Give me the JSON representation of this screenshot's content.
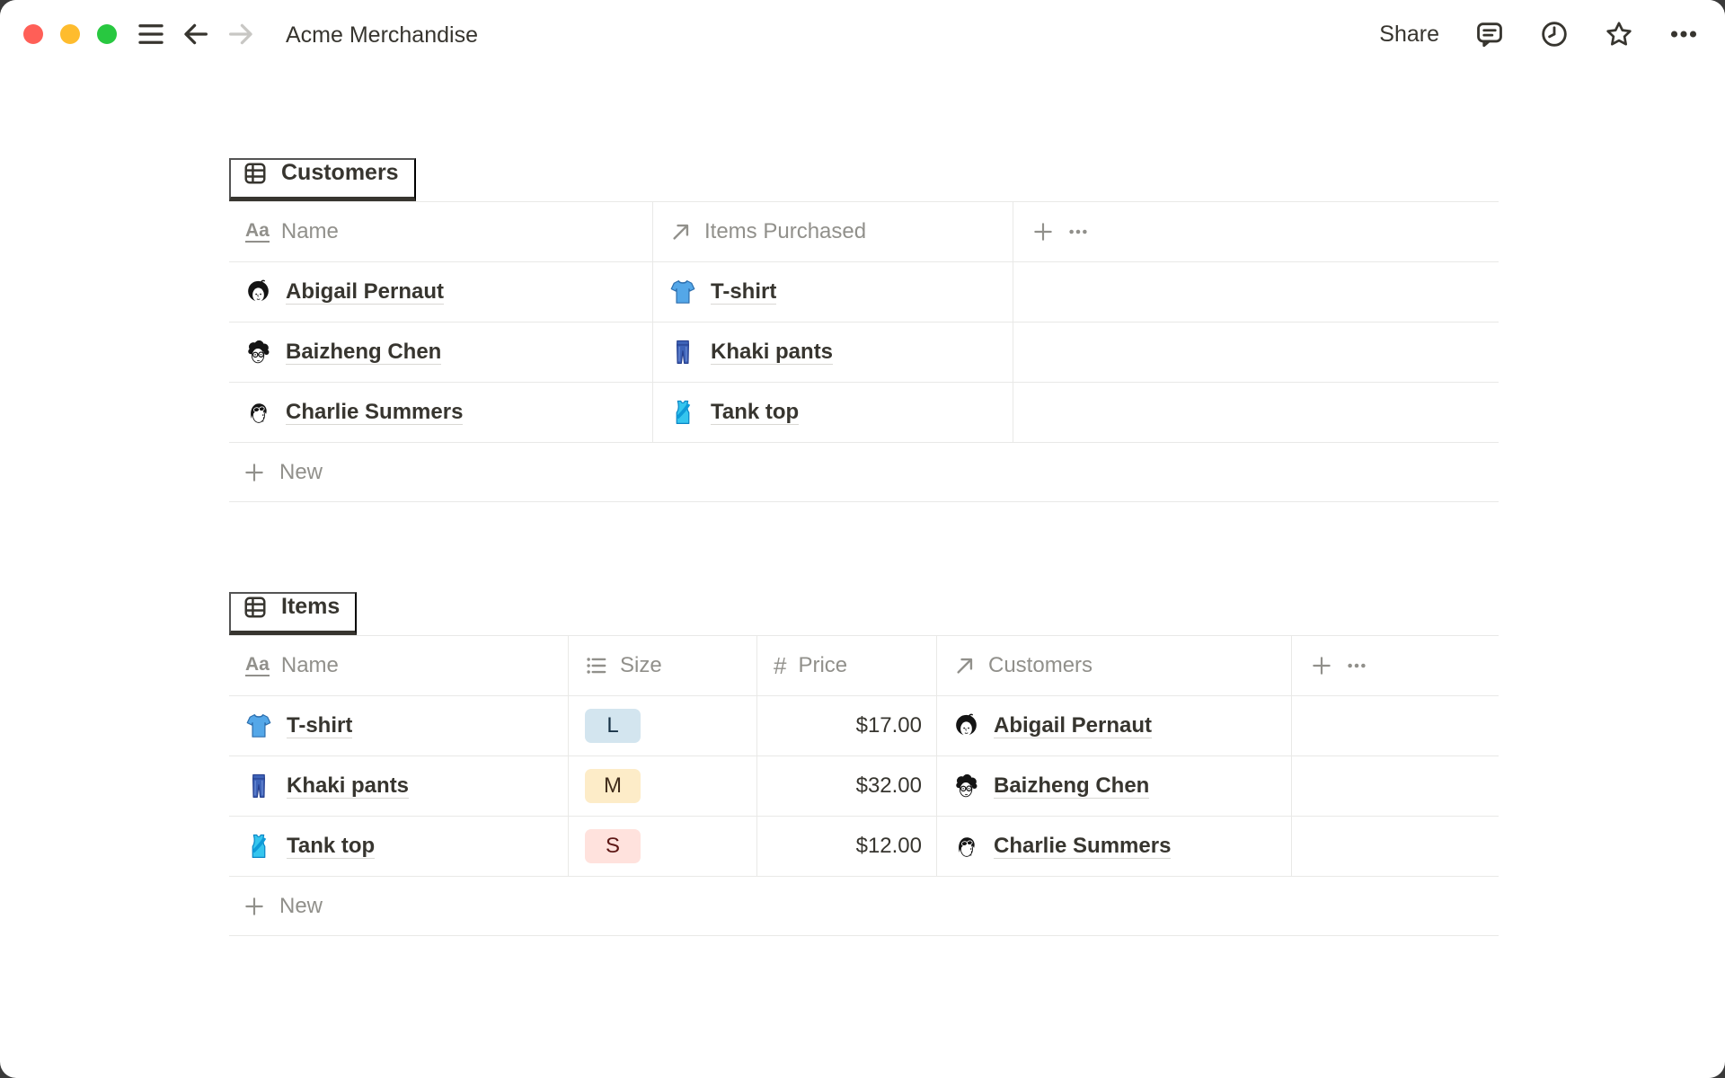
{
  "window": {
    "title": "Acme Merchandise",
    "traffic_lights": [
      "close",
      "minimize",
      "zoom"
    ]
  },
  "toolbar": {
    "share_label": "Share",
    "icons": [
      "comments-icon",
      "updates-clock-icon",
      "favorite-star-icon",
      "more-options-icon"
    ]
  },
  "nav_icons": [
    "menu-icon",
    "back-icon",
    "forward-icon"
  ],
  "icons": {
    "text_type": "Aa",
    "number_type": "#",
    "table_view": "table-grid-icon",
    "relation": "arrow-up-right-icon",
    "select": "bulleted-list-icon"
  },
  "customers": {
    "tab": "Customers",
    "columns": {
      "name": "Name",
      "items": "Items Purchased"
    },
    "rows": [
      {
        "name": "Abigail Pernaut",
        "item": "T-shirt"
      },
      {
        "name": "Baizheng Chen",
        "item": "Khaki pants"
      },
      {
        "name": "Charlie Summers",
        "item": "Tank top"
      }
    ],
    "new_label": "New"
  },
  "items": {
    "tab": "Items",
    "columns": {
      "name": "Name",
      "size": "Size",
      "price": "Price",
      "customers": "Customers"
    },
    "rows": [
      {
        "name": "T-shirt",
        "size": "L",
        "size_color": "blue",
        "price": "$17.00",
        "customer": "Abigail Pernaut"
      },
      {
        "name": "Khaki pants",
        "size": "M",
        "size_color": "yellow",
        "price": "$32.00",
        "customer": "Baizheng Chen"
      },
      {
        "name": "Tank top",
        "size": "S",
        "size_color": "red",
        "price": "$12.00",
        "customer": "Charlie Summers"
      }
    ],
    "new_label": "New"
  },
  "colors": {
    "text_dark": "#37352f",
    "text_gray": "#91908b",
    "border": "#e9e9e7",
    "link_underline": "#d9d8d4",
    "badge_blue_bg": "#d3e5ef",
    "badge_blue_text": "#183347",
    "badge_yellow_bg": "#fdecc8",
    "badge_yellow_text": "#402c1b",
    "badge_red_bg": "#ffe2dd",
    "badge_red_text": "#5d1715",
    "traffic_red": "#ff5f57",
    "traffic_yellow": "#febc2e",
    "traffic_green": "#28c840",
    "window_backdrop": "#3a3a3a"
  }
}
